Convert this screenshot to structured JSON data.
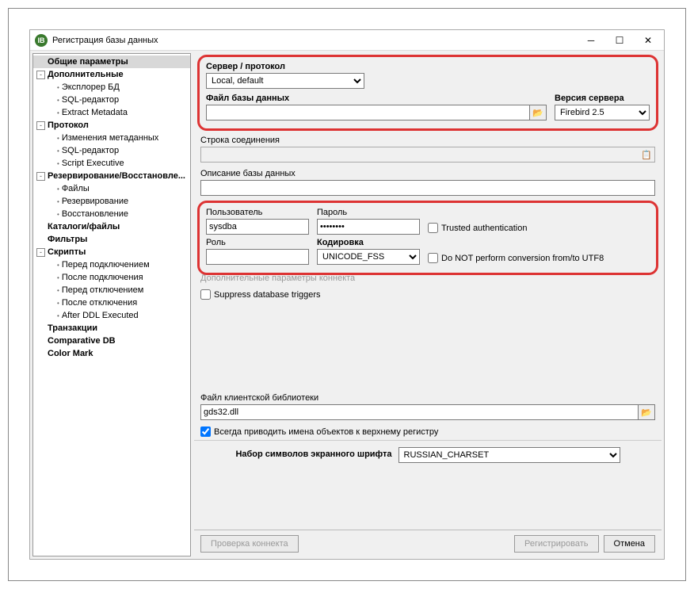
{
  "window": {
    "title": "Регистрация базы данных"
  },
  "sidebar": {
    "general": "Общие параметры",
    "additional": "Дополнительные",
    "db_explorer": "Эксплорер БД",
    "sql_editor": "SQL-редактор",
    "extract_metadata": "Extract Metadata",
    "protocol": "Протокол",
    "metadata_changes": "Изменения метаданных",
    "sql_editor2": "SQL-редактор",
    "script_executive": "Script Executive",
    "backup_restore": "Резервирование/Восстановле...",
    "files": "Файлы",
    "backup": "Резервирование",
    "restore": "Восстановление",
    "catalogs": "Каталоги/файлы",
    "filters": "Фильтры",
    "scripts": "Скрипты",
    "before_connect": "Перед подключением",
    "after_connect": "После подключения",
    "before_disconnect": "Перед отключением",
    "after_disconnect": "После отключения",
    "after_ddl": "After DDL Executed",
    "transactions": "Транзакции",
    "comparative": "Comparative DB",
    "color_mark": "Color Mark"
  },
  "main": {
    "server_protocol": "Сервер / протокол",
    "server_protocol_value": "Local, default",
    "db_file": "Файл базы данных",
    "server_version": "Версия сервера",
    "server_version_value": "Firebird 2.5",
    "conn_string": "Строка соединения",
    "db_description": "Описание базы данных",
    "user": "Пользователь",
    "user_value": "sysdba",
    "password": "Пароль",
    "password_value": "********",
    "trusted_auth": "Trusted authentication",
    "role": "Роль",
    "encoding": "Кодировка",
    "encoding_value": "UNICODE_FSS",
    "utf8": "Do NOT perform conversion from/to UTF8",
    "additional_params": "Дополнительные параметры коннекта",
    "suppress_triggers": "Suppress database triggers",
    "client_lib": "Файл клиентской библиотеки",
    "client_lib_value": "gds32.dll",
    "uppercase": "Всегда приводить имена объектов к верхнему регистру",
    "charset": "Набор символов экранного шрифта",
    "charset_value": "RUSSIAN_CHARSET"
  },
  "footer": {
    "test": "Проверка коннекта",
    "register": "Регистрировать",
    "cancel": "Отмена"
  }
}
